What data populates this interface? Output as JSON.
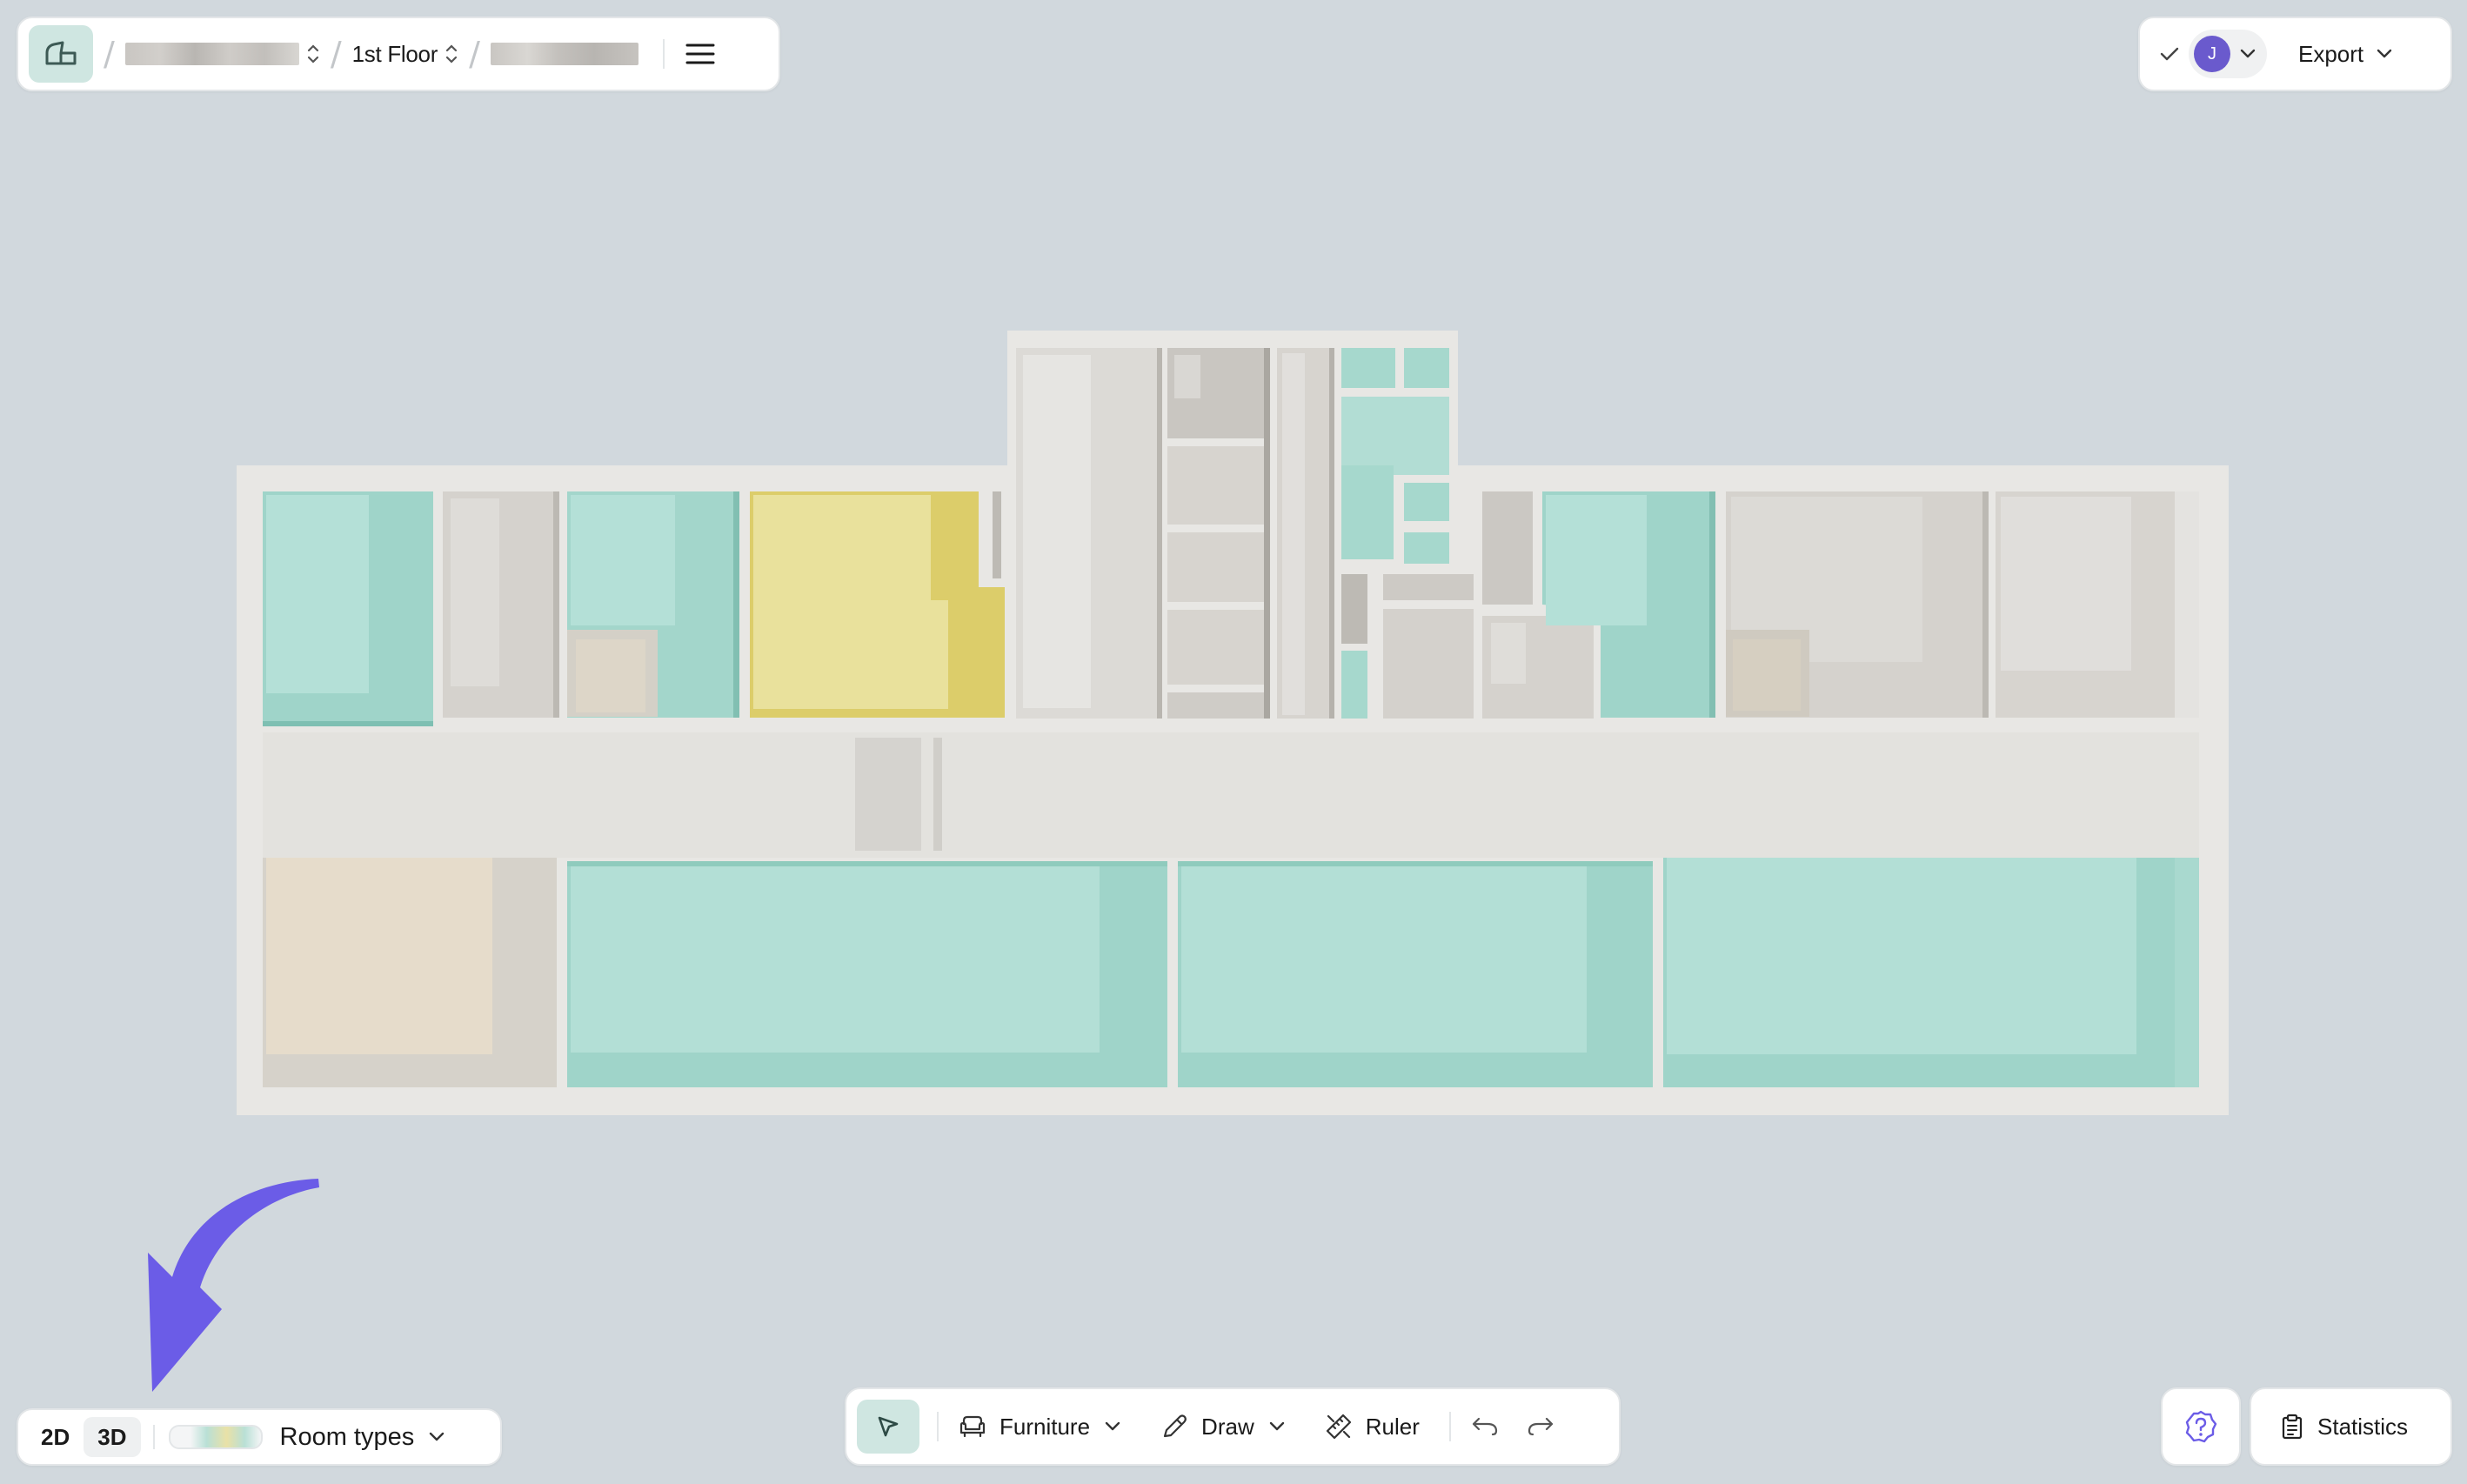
{
  "breadcrumb": {
    "floor_label": "1st Floor"
  },
  "header": {
    "user_initial": "J",
    "export_label": "Export"
  },
  "view_toggle": {
    "mode_2d": "2D",
    "mode_3d": "3D",
    "active": "3D"
  },
  "legend": {
    "room_types_label": "Room types"
  },
  "toolbar": {
    "furniture_label": "Furniture",
    "draw_label": "Draw",
    "ruler_label": "Ruler"
  },
  "statistics": {
    "label": "Statistics"
  },
  "colors": {
    "background": "#d1d8dd",
    "accent_teal": "#cfe6e1",
    "room_teal": "#b3dfd6",
    "room_yellow": "#e9e19c",
    "room_beige": "#e6dccb",
    "room_grey": "#d7d4cf",
    "corridor": "#e4e3e0",
    "avatar": "#6a5acd",
    "annotation_arrow": "#6b5ce7"
  },
  "icons": {
    "home": "floorplan-home-icon",
    "menu": "hamburger-menu-icon",
    "check": "check-icon",
    "select": "cursor-arrow-icon",
    "furniture": "armchair-icon",
    "draw": "pencil-icon",
    "ruler": "ruler-icon",
    "undo": "undo-icon",
    "redo": "redo-icon",
    "help": "help-badge-icon",
    "statistics": "clipboard-icon"
  }
}
